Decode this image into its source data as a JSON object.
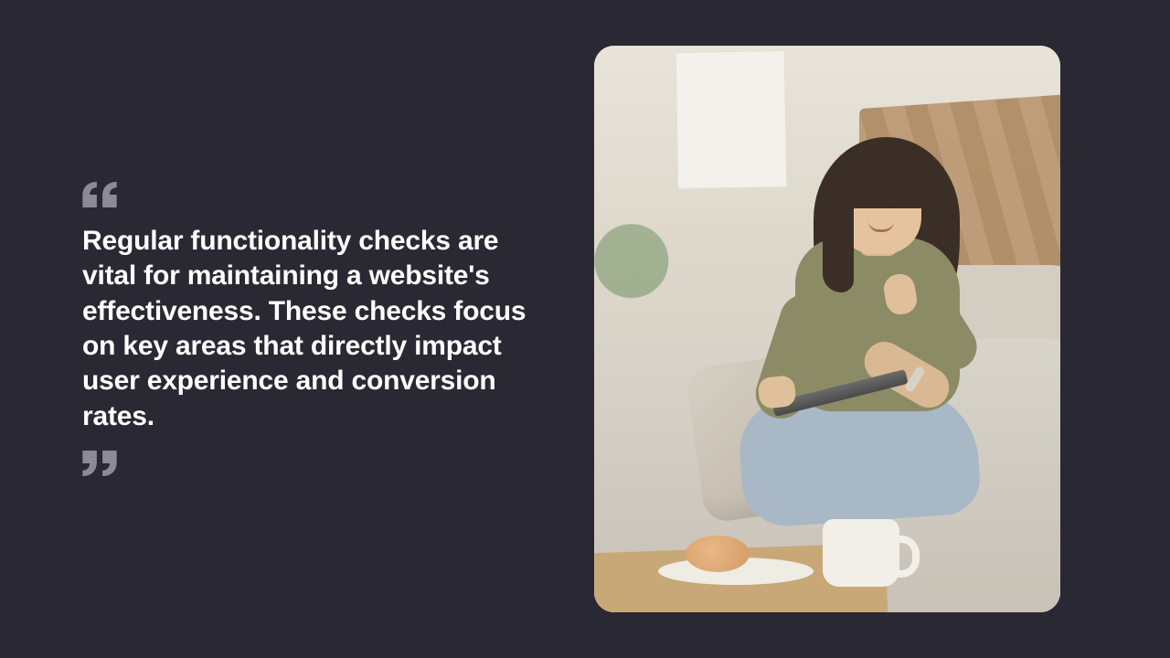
{
  "quote": {
    "text": "Regular functionality checks are vital for maintaining a website's effectiveness. These checks focus on key areas that directly impact user experience and conversion rates."
  },
  "image": {
    "alt": "Woman sitting cross-legged on a sofa with a pillow, smiling while looking at a tablet, with a mug and pastry on a wooden tray in the foreground"
  }
}
